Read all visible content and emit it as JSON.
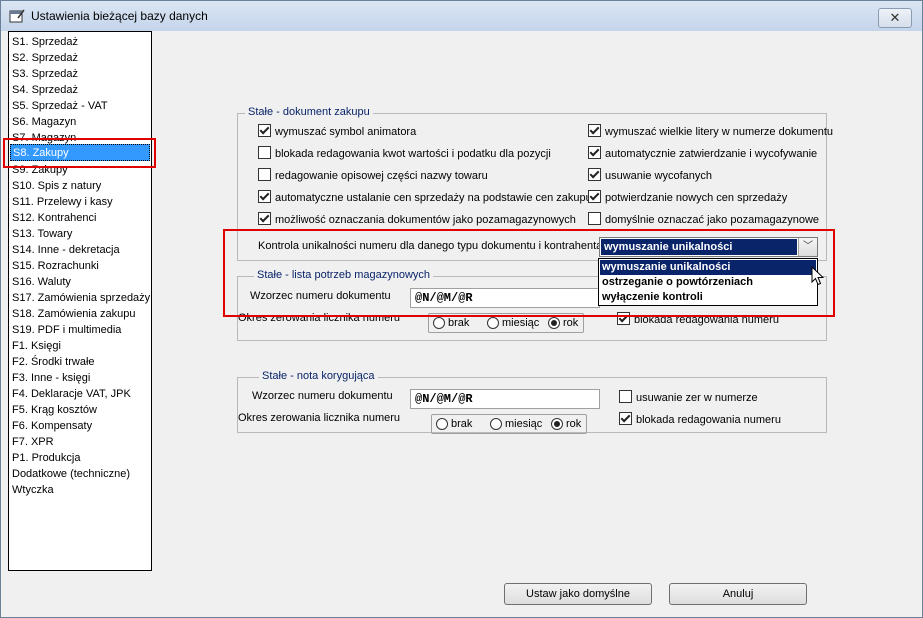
{
  "window": {
    "title": "Ustawienia bieżącej bazy danych",
    "close_glyph": "✕"
  },
  "sidebar": {
    "items": [
      {
        "label": "S1. Sprzedaż"
      },
      {
        "label": "S2. Sprzedaż"
      },
      {
        "label": "S3. Sprzedaż"
      },
      {
        "label": "S4. Sprzedaż"
      },
      {
        "label": "S5. Sprzedaż - VAT"
      },
      {
        "label": "S6. Magazyn"
      },
      {
        "label": "S7. Magazyn"
      },
      {
        "label": "S8. Zakupy"
      },
      {
        "label": "S9. Zakupy"
      },
      {
        "label": "S10. Spis z natury"
      },
      {
        "label": "S11. Przelewy i kasy"
      },
      {
        "label": "S12. Kontrahenci"
      },
      {
        "label": "S13. Towary"
      },
      {
        "label": "S14. Inne - dekretacja"
      },
      {
        "label": "S15. Rozrachunki"
      },
      {
        "label": "S16. Waluty"
      },
      {
        "label": "S17. Zamówienia sprzedaży"
      },
      {
        "label": "S18. Zamówienia zakupu"
      },
      {
        "label": "S19. PDF i multimedia"
      },
      {
        "label": "F1. Księgi"
      },
      {
        "label": "F2. Środki trwałe"
      },
      {
        "label": "F3. Inne - księgi"
      },
      {
        "label": "F4. Deklaracje VAT, JPK"
      },
      {
        "label": "F5. Krąg kosztów"
      },
      {
        "label": "F6. Kompensaty"
      },
      {
        "label": "F7. XPR"
      },
      {
        "label": "P1. Produkcja"
      },
      {
        "label": "Dodatkowe (techniczne)"
      },
      {
        "label": "Wtyczka"
      }
    ],
    "selected_index": 7
  },
  "group_zakup": {
    "title": "Stałe - dokument zakupu",
    "left": [
      {
        "label": "wymuszać symbol animatora",
        "checked": true
      },
      {
        "label": "blokada redagowania kwot wartości i podatku dla pozycji",
        "checked": false
      },
      {
        "label": "redagowanie opisowej części nazwy towaru",
        "checked": false
      },
      {
        "label": "automatyczne ustalanie cen sprzedaży na podstawie cen zakupu",
        "checked": true
      },
      {
        "label": "możliwość oznaczania dokumentów jako pozamagazynowych",
        "checked": true
      }
    ],
    "right": [
      {
        "label": "wymuszać wielkie litery w numerze dokumentu",
        "checked": true
      },
      {
        "label": "automatycznie zatwierdzanie i wycofywanie",
        "checked": true
      },
      {
        "label": "usuwanie wycofanych",
        "checked": true
      },
      {
        "label": "potwierdzanie nowych cen sprzedaży",
        "checked": true
      },
      {
        "label": "domyślnie oznaczać jako pozamagazynowe",
        "checked": false
      }
    ],
    "uniq_label": "Kontrola unikalności numeru dla danego typu dokumentu i kontrahenta",
    "uniq_value": "wymuszanie unikalności",
    "uniq_options": [
      "wymuszanie unikalności",
      "ostrzeganie o powtórzeniach",
      "wyłączenie kontroli"
    ]
  },
  "group_lista": {
    "title": "Stałe - lista potrzeb magazynowych",
    "pattern_label": "Wzorzec numeru dokumentu",
    "pattern_value": "@N/@M/@R",
    "reset_label": "Okres zerowania licznika numeru",
    "radios": [
      {
        "label": "brak",
        "on": false
      },
      {
        "label": "miesiąc",
        "on": false
      },
      {
        "label": "rok",
        "on": true
      }
    ],
    "block_label": "blokada redagowania numeru",
    "block_checked": true
  },
  "group_nota": {
    "title": "Stałe - nota korygująca",
    "pattern_label": "Wzorzec numeru dokumentu",
    "pattern_value": "@N/@M/@R",
    "reset_label": "Okres zerowania licznika numeru",
    "radios": [
      {
        "label": "brak",
        "on": false
      },
      {
        "label": "miesiąc",
        "on": false
      },
      {
        "label": "rok",
        "on": true
      }
    ],
    "zeros_label": "usuwanie zer w numerze",
    "zeros_checked": false,
    "block_label": "blokada redagowania numeru",
    "block_checked": true
  },
  "buttons": {
    "default_label": "Ustaw jako domyślne",
    "cancel_label": "Anuluj"
  }
}
